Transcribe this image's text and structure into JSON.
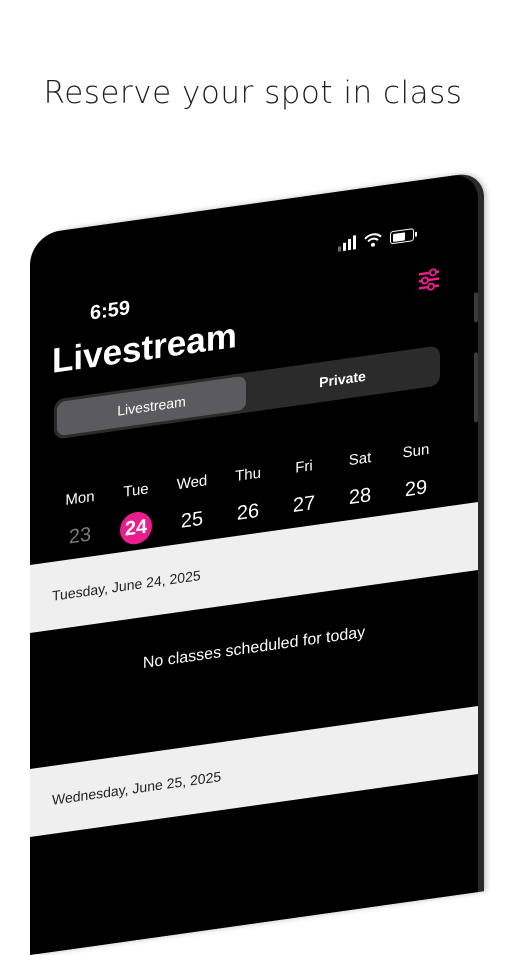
{
  "headline": "Reserve your spot in class",
  "status_bar": {
    "time": "6:59",
    "icons": [
      "signal-icon",
      "wifi-icon",
      "battery-icon"
    ]
  },
  "header": {
    "title": "Livestream",
    "filter_icon": "sliders-icon"
  },
  "segmented": {
    "options": [
      {
        "label": "Livestream",
        "active": true
      },
      {
        "label": "Private",
        "active": false
      }
    ]
  },
  "week": [
    {
      "day": "Mon",
      "date": "23",
      "state": "past"
    },
    {
      "day": "Tue",
      "date": "24",
      "state": "selected"
    },
    {
      "day": "Wed",
      "date": "25",
      "state": "upcoming"
    },
    {
      "day": "Thu",
      "date": "26",
      "state": "upcoming"
    },
    {
      "day": "Fri",
      "date": "27",
      "state": "upcoming"
    },
    {
      "day": "Sat",
      "date": "28",
      "state": "upcoming"
    },
    {
      "day": "Sun",
      "date": "29",
      "state": "upcoming"
    }
  ],
  "schedule": [
    {
      "date_label": "Tuesday, June 24, 2025",
      "empty_message": "No classes scheduled for today"
    },
    {
      "date_label": "Wednesday, June 25, 2025"
    }
  ],
  "colors": {
    "accent": "#e91e8c",
    "background": "#000000",
    "segment_active": "#5b5b5f",
    "date_band": "#efefef"
  }
}
